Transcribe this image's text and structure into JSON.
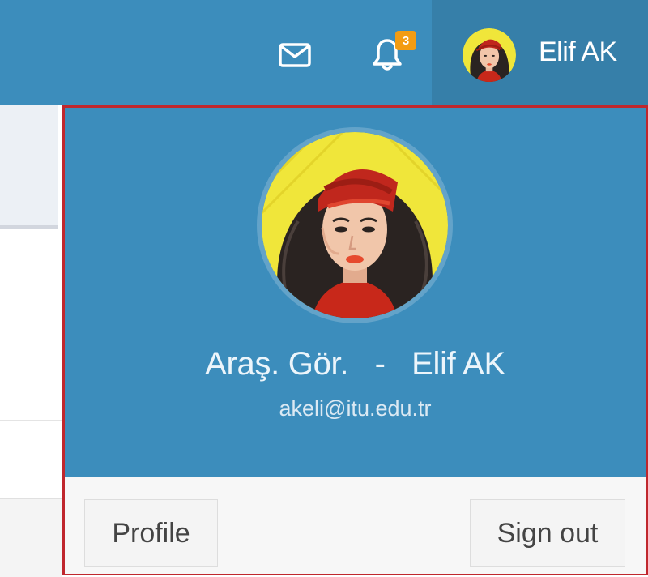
{
  "navbar": {
    "mail_icon": "envelope-icon",
    "notifications": {
      "icon": "bell-icon",
      "badge_count": "3",
      "badge_color": "#f39c12"
    },
    "user": {
      "name": "Elif AK",
      "avatar": "avatar-woman-red-beret"
    },
    "color": "#3c8dbc"
  },
  "dropdown": {
    "title": "Araş. Gör.",
    "separator": "-",
    "full_name": "Elif AK",
    "email": "akeli@itu.edu.tr",
    "profile_label": "Profile",
    "signout_label": "Sign out",
    "highlight_color": "#c0272d"
  }
}
